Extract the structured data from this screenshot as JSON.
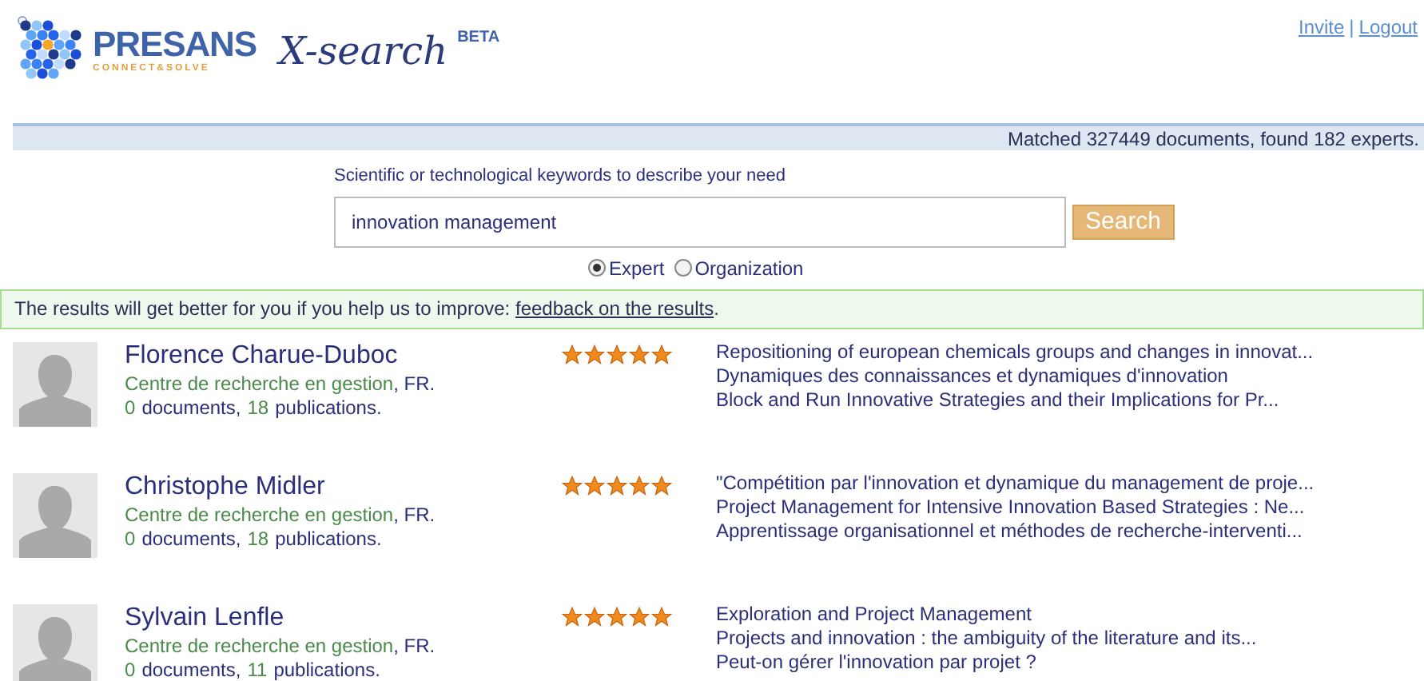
{
  "logo": {
    "brand": "PRESANS",
    "tagline": "CONNECT&SOLVE",
    "product": "X-search",
    "badge": "BETA"
  },
  "header_links": [
    {
      "label": "Invite"
    },
    {
      "label": "Logout"
    }
  ],
  "header_separator": "|",
  "status_bar": "Matched 327449 documents, found 182 experts.",
  "search": {
    "label": "Scientific or technological keywords to describe your need",
    "value": "innovation management",
    "button": "Search"
  },
  "search_type": [
    {
      "label": "Expert",
      "selected": true
    },
    {
      "label": "Organization",
      "selected": false
    }
  ],
  "feedback": {
    "text": "The results will get better for you if you help us to improve: ",
    "link": "feedback on the results",
    "end": "."
  },
  "experts": [
    {
      "name": "Florence Charue-Duboc",
      "organization": "Centre de recherche en gestion",
      "country": ", FR.",
      "documents_count": "0",
      "documents_label": "documents,",
      "publications_count": "18",
      "publications_label": "publications.",
      "stars": 5,
      "publications": [
        "Repositioning of european chemicals groups and changes in innovat...",
        "Dynamiques des connaissances et dynamiques d'innovation",
        "Block and Run Innovative Strategies and their Implications for Pr..."
      ]
    },
    {
      "name": "Christophe Midler",
      "organization": "Centre de recherche en gestion",
      "country": ", FR.",
      "documents_count": "0",
      "documents_label": "documents,",
      "publications_count": "18",
      "publications_label": "publications.",
      "stars": 5,
      "publications": [
        "\"Compétition par l'innovation et dynamique du management de proje...",
        "Project Management for Intensive Innovation Based Strategies : Ne...",
        "Apprentissage organisationnel et méthodes de recherche-interventi..."
      ]
    },
    {
      "name": "Sylvain Lenfle",
      "organization": "Centre de recherche en gestion",
      "country": ", FR.",
      "documents_count": "0",
      "documents_label": "documents,",
      "publications_count": "11",
      "publications_label": "publications.",
      "stars": 5,
      "publications": [
        "Exploration and Project Management",
        "Projects and innovation : the ambiguity of the literature and its...",
        "Peut-on gérer l'innovation par projet ?"
      ]
    }
  ]
}
